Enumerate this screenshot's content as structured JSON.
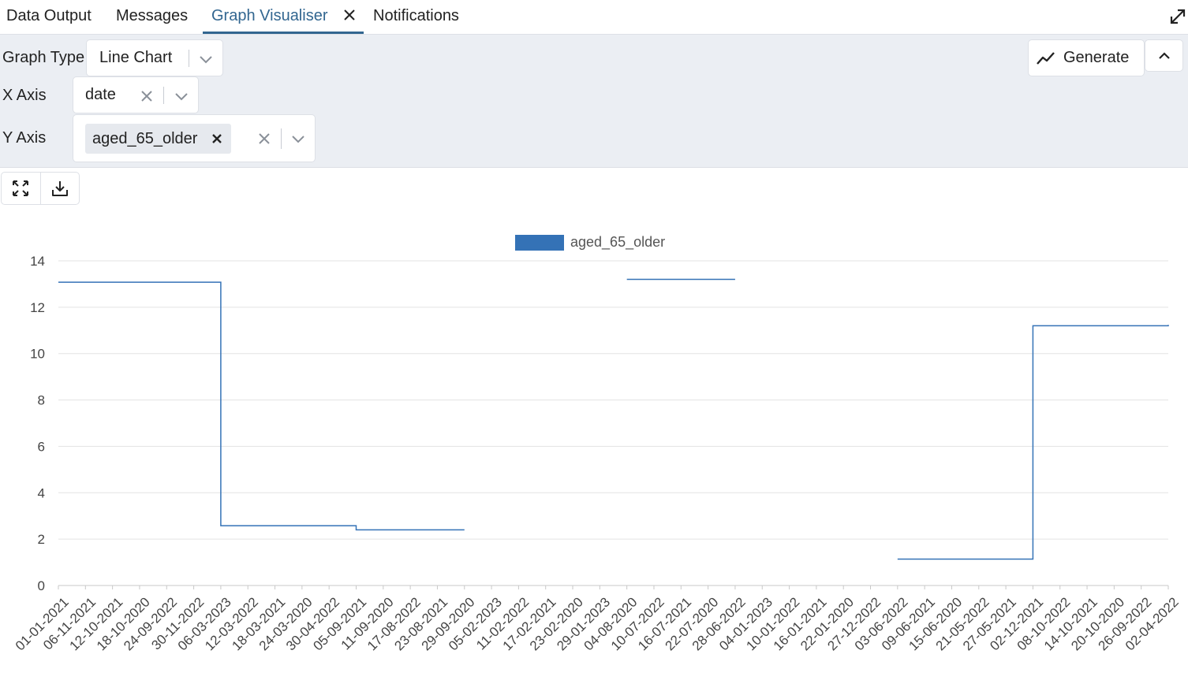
{
  "tabs": [
    {
      "label": "Data Output",
      "active": false
    },
    {
      "label": "Messages",
      "active": false
    },
    {
      "label": "Graph Visualiser",
      "active": true,
      "closable": true
    },
    {
      "label": "Notifications",
      "active": false
    }
  ],
  "options": {
    "graph_type": {
      "label": "Graph Type",
      "value": "Line Chart"
    },
    "x_axis": {
      "label": "X Axis",
      "value": "date"
    },
    "y_axis": {
      "label": "Y Axis",
      "chips": [
        "aged_65_older"
      ]
    },
    "generate_label": "Generate"
  },
  "icons": {
    "expand": "expand-diagonal-icon",
    "close": "close-icon",
    "chevron": "chevron-down-icon",
    "collapse": "chevron-up-icon",
    "generate": "line-chart-icon",
    "fullscreen": "fullscreen-icon",
    "download": "download-icon"
  },
  "colors": {
    "accent": "#326690",
    "series": "#3472b6",
    "panel": "#ebeef3"
  },
  "chart_data": {
    "type": "line",
    "step": true,
    "legend": "top-center",
    "grid": true,
    "ylim": [
      0,
      14
    ],
    "yticks": [
      0,
      2,
      4,
      6,
      8,
      10,
      12,
      14
    ],
    "categories": [
      "01-01-2021",
      "06-11-2021",
      "12-10-2021",
      "18-10-2020",
      "24-09-2022",
      "30-11-2022",
      "06-03-2023",
      "12-03-2022",
      "18-03-2021",
      "24-03-2020",
      "30-04-2022",
      "05-09-2021",
      "11-09-2020",
      "17-08-2022",
      "23-08-2021",
      "29-09-2020",
      "05-02-2023",
      "11-02-2022",
      "17-02-2021",
      "23-02-2020",
      "29-01-2023",
      "04-08-2020",
      "10-07-2022",
      "16-07-2021",
      "22-07-2020",
      "28-06-2022",
      "04-01-2023",
      "10-01-2022",
      "16-01-2021",
      "22-01-2020",
      "27-12-2022",
      "03-06-2022",
      "09-06-2021",
      "15-06-2020",
      "21-05-2022",
      "27-05-2021",
      "02-12-2021",
      "08-10-2022",
      "14-10-2021",
      "20-10-2020",
      "26-09-2022",
      "02-04-2022"
    ],
    "series": [
      {
        "name": "aged_65_older",
        "values": [
          13.08,
          13.08,
          13.08,
          13.08,
          13.08,
          13.08,
          2.58,
          2.58,
          2.58,
          2.58,
          2.58,
          2.4,
          2.4,
          2.4,
          2.4,
          2.4,
          null,
          null,
          null,
          null,
          null,
          13.2,
          13.2,
          13.2,
          13.2,
          13.2,
          null,
          null,
          null,
          null,
          null,
          1.14,
          1.14,
          1.14,
          1.14,
          1.14,
          11.2,
          11.2,
          11.2,
          11.2,
          11.2,
          11.24
        ]
      }
    ]
  }
}
